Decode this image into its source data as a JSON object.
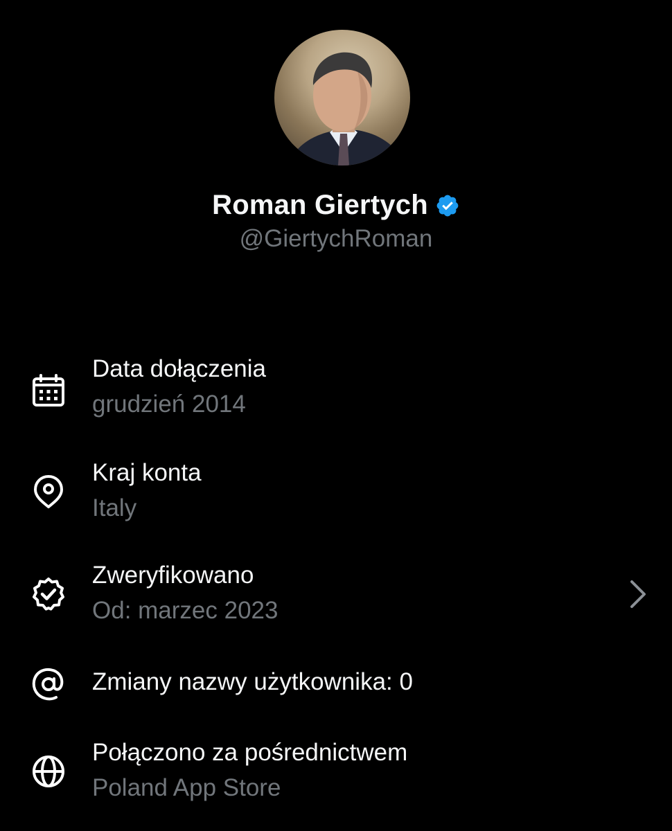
{
  "profile": {
    "display_name": "Roman Giertych",
    "handle": "@GiertychRoman",
    "verified_color": "#1d9bf0"
  },
  "info": {
    "joined": {
      "label": "Data dołączenia",
      "value": "grudzień 2014",
      "icon": "calendar-icon"
    },
    "country": {
      "label": "Kraj konta",
      "value": "Italy",
      "icon": "location-pin-icon"
    },
    "verified": {
      "label": "Zweryfikowano",
      "value": "Od: marzec 2023",
      "icon": "verified-badge-outline-icon"
    },
    "username_changes": {
      "label": "Zmiany nazwy użytkownika: 0",
      "icon": "at-sign-icon"
    },
    "connected_via": {
      "label": "Połączono za pośrednictwem",
      "value": "Poland App Store",
      "icon": "globe-icon"
    }
  },
  "colors": {
    "background": "#000000",
    "primary_text": "#e7e9ea",
    "secondary_text": "#71767b",
    "accent": "#1d9bf0"
  }
}
